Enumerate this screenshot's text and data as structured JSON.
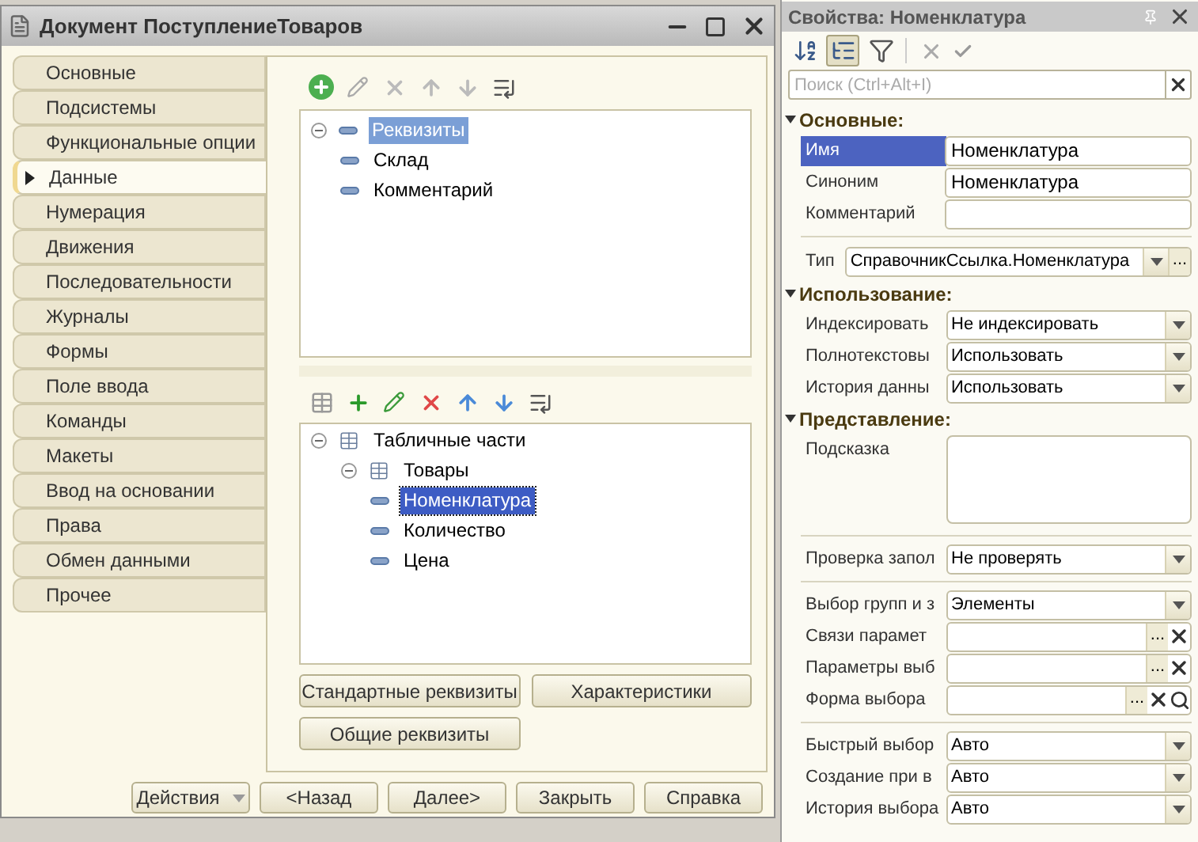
{
  "window": {
    "title": "Документ ПоступлениеТоваров"
  },
  "tabs": [
    {
      "label": "Основные",
      "selected": false
    },
    {
      "label": "Подсистемы",
      "selected": false
    },
    {
      "label": "Функциональные опции",
      "selected": false
    },
    {
      "label": "Данные",
      "selected": true
    },
    {
      "label": "Нумерация",
      "selected": false
    },
    {
      "label": "Движения",
      "selected": false
    },
    {
      "label": "Последовательности",
      "selected": false
    },
    {
      "label": "Журналы",
      "selected": false
    },
    {
      "label": "Формы",
      "selected": false
    },
    {
      "label": "Поле ввода",
      "selected": false
    },
    {
      "label": "Команды",
      "selected": false
    },
    {
      "label": "Макеты",
      "selected": false
    },
    {
      "label": "Ввод на основании",
      "selected": false
    },
    {
      "label": "Права",
      "selected": false
    },
    {
      "label": "Обмен данными",
      "selected": false
    },
    {
      "label": "Прочее",
      "selected": false
    }
  ],
  "attributes_tree": {
    "active": false,
    "nodes": [
      {
        "label": "Реквизиты",
        "kind": "attribute",
        "expanded": true,
        "selected": true,
        "children": [
          {
            "label": "Склад",
            "kind": "attribute",
            "selected": false
          },
          {
            "label": "Комментарий",
            "kind": "attribute",
            "selected": false
          }
        ]
      }
    ]
  },
  "tabular_tree": {
    "active": true,
    "nodes": [
      {
        "label": "Табличные части",
        "kind": "table",
        "expanded": true,
        "selected": false,
        "children": [
          {
            "label": "Товары",
            "kind": "table",
            "expanded": true,
            "selected": false,
            "children": [
              {
                "label": "Номенклатура",
                "kind": "attribute",
                "selected": true
              },
              {
                "label": "Количество",
                "kind": "attribute",
                "selected": false
              },
              {
                "label": "Цена",
                "kind": "attribute",
                "selected": false
              }
            ]
          }
        ]
      }
    ]
  },
  "content_buttons": [
    "Стандартные реквизиты",
    "Характеристики",
    "Общие реквизиты"
  ],
  "footer_buttons": [
    {
      "label": "Действия",
      "dropdown": true
    },
    {
      "label": "<Назад",
      "dropdown": false
    },
    {
      "label": "Далее>",
      "dropdown": false
    },
    {
      "label": "Закрыть",
      "dropdown": false
    },
    {
      "label": "Справка",
      "dropdown": false
    }
  ],
  "properties": {
    "title": "Свойства: Номенклатура",
    "toolbar": [
      {
        "kind": "sort",
        "selected": false
      },
      {
        "kind": "categories",
        "selected": true
      },
      {
        "kind": "filter",
        "selected": false
      }
    ],
    "search": {
      "placeholder": "Поиск (Ctrl+Alt+I)"
    },
    "rows": [
      {
        "kind": "section",
        "label": "Основные:",
        "expanded": true
      },
      {
        "kind": "field",
        "label": "Имя",
        "value": "Номенклатура",
        "selected": true
      },
      {
        "kind": "field",
        "label": "Синоним",
        "value": "Номенклатура",
        "selected": false
      },
      {
        "kind": "field",
        "label": "Комментарий",
        "selected": false
      },
      {
        "kind": "divider"
      },
      {
        "kind": "type",
        "label": "Тип",
        "value": "СправочникСсылка.Номенклатура",
        "more": "..."
      },
      {
        "kind": "section",
        "label": "Использование:",
        "expanded": true
      },
      {
        "kind": "select",
        "label": "Индексировать",
        "value": "Не индексировать"
      },
      {
        "kind": "select",
        "label": "Полнотекстовы",
        "value": "Использовать"
      },
      {
        "kind": "select",
        "label": "История данны",
        "value": "Использовать"
      },
      {
        "kind": "section",
        "label": "Представление:",
        "expanded": true
      },
      {
        "kind": "memo",
        "label": "Подсказка"
      },
      {
        "kind": "divider"
      },
      {
        "kind": "select",
        "label": "Проверка запол",
        "value": "Не проверять"
      },
      {
        "kind": "divider"
      },
      {
        "kind": "select",
        "label": "Выбор групп и з",
        "value": "Элементы"
      },
      {
        "kind": "picker",
        "label": "Связи парамет",
        "more": "...",
        "clear": true,
        "search": false
      },
      {
        "kind": "picker",
        "label": "Параметры выб",
        "more": "...",
        "clear": true,
        "search": false
      },
      {
        "kind": "picker",
        "label": "Форма выбора",
        "more": "...",
        "clear": true,
        "search": true
      },
      {
        "kind": "divider"
      },
      {
        "kind": "select",
        "label": "Быстрый выбор",
        "value": "Авто"
      },
      {
        "kind": "select",
        "label": "Создание при в",
        "value": "Авто"
      },
      {
        "kind": "select",
        "label": "История выбора",
        "value": "Авто"
      }
    ]
  }
}
